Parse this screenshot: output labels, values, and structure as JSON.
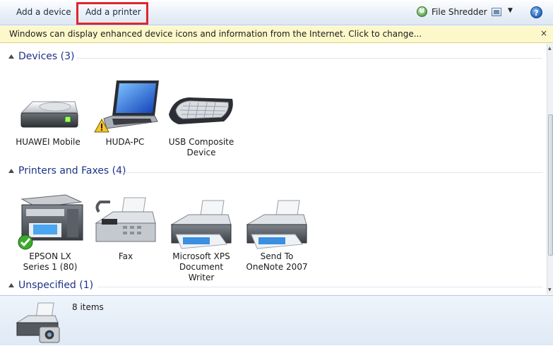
{
  "toolbar": {
    "add_device": "Add a device",
    "add_printer": "Add a printer",
    "file_shredder": "File Shredder",
    "help_glyph": "?",
    "dropdown_glyph": "▼"
  },
  "infobar": {
    "message": "Windows can display enhanced device icons and information from the Internet. Click to change...",
    "close_glyph": "×"
  },
  "groups": {
    "devices": {
      "title": "Devices (3)",
      "items": [
        {
          "label": "HUAWEI Mobile",
          "icon": "drive-icon"
        },
        {
          "label": "HUDA-PC",
          "icon": "laptop-icon",
          "badge": "warning"
        },
        {
          "label": "USB Composite Device",
          "icon": "keyboard-icon"
        }
      ]
    },
    "printers": {
      "title": "Printers and Faxes (4)",
      "items": [
        {
          "label": "EPSON LX Series 1 (80)",
          "icon": "multifunction-printer-icon",
          "badge": "default-check"
        },
        {
          "label": "Fax",
          "icon": "fax-icon"
        },
        {
          "label": "Microsoft XPS Document Writer",
          "icon": "printer-icon"
        },
        {
          "label": "Send To OneNote 2007",
          "icon": "printer-icon"
        }
      ]
    },
    "unspecified": {
      "title": "Unspecified (1)"
    }
  },
  "details": {
    "count": "8 items"
  },
  "colors": {
    "highlight": "#e0252b",
    "group_title": "#1e3287",
    "infobar_bg": "#fdf8c9"
  }
}
